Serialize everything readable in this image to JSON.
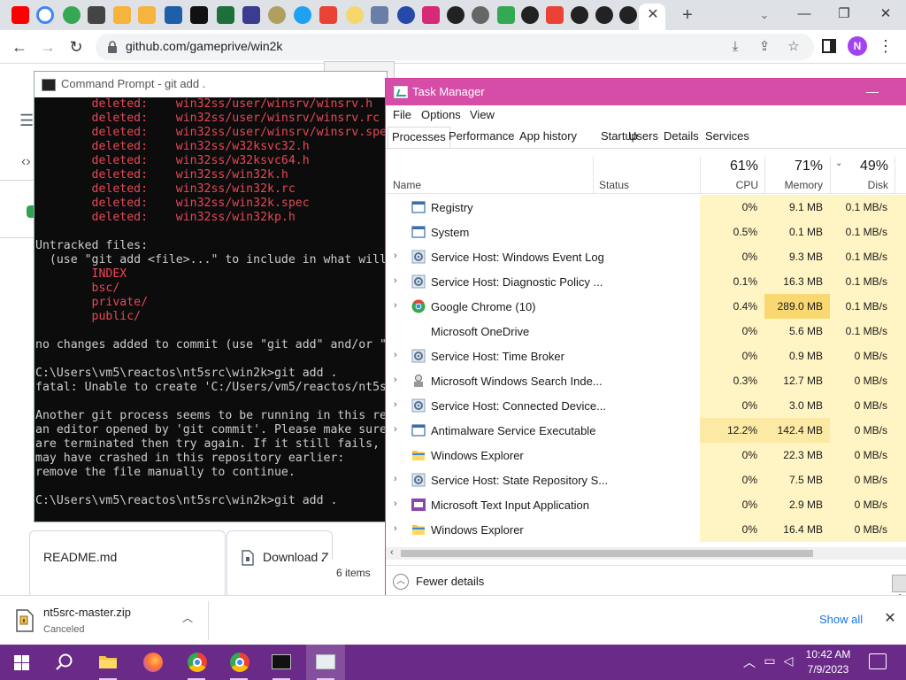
{
  "browser": {
    "url": "github.com/gameprive/win2k",
    "profile_initial": "N"
  },
  "github_page": {
    "readme_label": "README.md",
    "download_label": "Download Z"
  },
  "explorer": {
    "status": "6 items"
  },
  "cmd": {
    "title": "Command Prompt - git  add .",
    "lines": [
      {
        "text": "        deleted:    win32ss/user/winsrv/winsrv.h",
        "red": true
      },
      {
        "text": "        deleted:    win32ss/user/winsrv/winsrv.rc",
        "red": true
      },
      {
        "text": "        deleted:    win32ss/user/winsrv/winsrv.spec",
        "red": true
      },
      {
        "text": "        deleted:    win32ss/w32ksvc32.h",
        "red": true
      },
      {
        "text": "        deleted:    win32ss/w32ksvc64.h",
        "red": true
      },
      {
        "text": "        deleted:    win32ss/win32k.h",
        "red": true
      },
      {
        "text": "        deleted:    win32ss/win32k.rc",
        "red": true
      },
      {
        "text": "        deleted:    win32ss/win32k.spec",
        "red": true
      },
      {
        "text": "        deleted:    win32ss/win32kp.h",
        "red": true
      },
      {
        "text": "",
        "red": false
      },
      {
        "text": "Untracked files:",
        "red": false
      },
      {
        "text": "  (use \"git add <file>...\" to include in what will",
        "red": false
      },
      {
        "text": "        INDEX",
        "red": true
      },
      {
        "text": "        bsc/",
        "red": true
      },
      {
        "text": "        private/",
        "red": true
      },
      {
        "text": "        public/",
        "red": true
      },
      {
        "text": "",
        "red": false
      },
      {
        "text": "no changes added to commit (use \"git add\" and/or \"",
        "red": false
      },
      {
        "text": "",
        "red": false
      },
      {
        "text": "C:\\Users\\vm5\\reactos\\nt5src\\win2k>git add .",
        "red": false
      },
      {
        "text": "fatal: Unable to create 'C:/Users/vm5/reactos/nt5s",
        "red": false
      },
      {
        "text": "",
        "red": false
      },
      {
        "text": "Another git process seems to be running in this re",
        "red": false
      },
      {
        "text": "an editor opened by 'git commit'. Please make sure",
        "red": false
      },
      {
        "text": "are terminated then try again. If it still fails,",
        "red": false
      },
      {
        "text": "may have crashed in this repository earlier:",
        "red": false
      },
      {
        "text": "remove the file manually to continue.",
        "red": false
      },
      {
        "text": "",
        "red": false
      },
      {
        "text": "C:\\Users\\vm5\\reactos\\nt5src\\win2k>git add .",
        "red": false
      }
    ]
  },
  "taskmgr": {
    "title": "Task Manager",
    "menu": [
      "File",
      "Options",
      "View"
    ],
    "tabs": [
      "Processes",
      "Performance",
      "App history",
      "Startup",
      "Users",
      "Details",
      "Services"
    ],
    "columns": {
      "name": "Name",
      "status": "Status",
      "cpu_pct": "61%",
      "cpu": "CPU",
      "mem_pct": "71%",
      "mem": "Memory",
      "disk_pct": "49%",
      "disk": "Disk"
    },
    "rows": [
      {
        "name": "Registry",
        "expandable": false,
        "icon": "window-icon",
        "cpu": "0%",
        "mem": "9.1 MB",
        "disk": "0.1 MB/s"
      },
      {
        "name": "System",
        "expandable": false,
        "icon": "window-icon",
        "cpu": "0.5%",
        "mem": "0.1 MB",
        "disk": "0.1 MB/s"
      },
      {
        "name": "Service Host: Windows Event Log",
        "expandable": true,
        "icon": "gear-icon",
        "cpu": "0%",
        "mem": "9.3 MB",
        "disk": "0.1 MB/s"
      },
      {
        "name": "Service Host: Diagnostic Policy ...",
        "expandable": true,
        "icon": "gear-icon",
        "cpu": "0.1%",
        "mem": "16.3 MB",
        "disk": "0.1 MB/s"
      },
      {
        "name": "Google Chrome (10)",
        "expandable": true,
        "icon": "chrome-icon",
        "cpu": "0.4%",
        "mem": "289.0 MB",
        "disk": "0.1 MB/s"
      },
      {
        "name": "Microsoft OneDrive",
        "expandable": false,
        "icon": "none",
        "cpu": "0%",
        "mem": "5.6 MB",
        "disk": "0.1 MB/s"
      },
      {
        "name": "Service Host: Time Broker",
        "expandable": true,
        "icon": "gear-icon",
        "cpu": "0%",
        "mem": "0.9 MB",
        "disk": "0 MB/s"
      },
      {
        "name": "Microsoft Windows Search Inde...",
        "expandable": true,
        "icon": "search-indexer-icon",
        "cpu": "0.3%",
        "mem": "12.7 MB",
        "disk": "0 MB/s"
      },
      {
        "name": "Service Host: Connected Device...",
        "expandable": true,
        "icon": "gear-icon",
        "cpu": "0%",
        "mem": "3.0 MB",
        "disk": "0 MB/s"
      },
      {
        "name": "Antimalware Service Executable",
        "expandable": true,
        "icon": "window-icon",
        "cpu": "12.2%",
        "mem": "142.4 MB",
        "disk": "0 MB/s"
      },
      {
        "name": "Windows Explorer",
        "expandable": false,
        "icon": "folder-icon",
        "cpu": "0%",
        "mem": "22.3 MB",
        "disk": "0 MB/s"
      },
      {
        "name": "Service Host: State Repository S...",
        "expandable": true,
        "icon": "gear-icon",
        "cpu": "0%",
        "mem": "7.5 MB",
        "disk": "0 MB/s"
      },
      {
        "name": "Microsoft Text Input Application",
        "expandable": true,
        "icon": "text-input-icon",
        "cpu": "0%",
        "mem": "2.9 MB",
        "disk": "0 MB/s"
      },
      {
        "name": "Windows Explorer",
        "expandable": true,
        "icon": "folder-icon",
        "cpu": "0%",
        "mem": "16.4 MB",
        "disk": "0 MB/s"
      }
    ],
    "fewer_details": "Fewer details"
  },
  "download_bar": {
    "file_name": "nt5src-master.zip",
    "status": "Canceled",
    "show_all": "Show all"
  },
  "taskbar": {
    "time": "10:42 AM",
    "date": "7/9/2023"
  },
  "colors": {
    "accent": "#d64da8",
    "taskbar": "#6a2a88",
    "cmd_red": "#e74856",
    "heat_light": "#fff4c4",
    "heat_mid": "#fce9a4",
    "heat_high": "#f9d872"
  }
}
